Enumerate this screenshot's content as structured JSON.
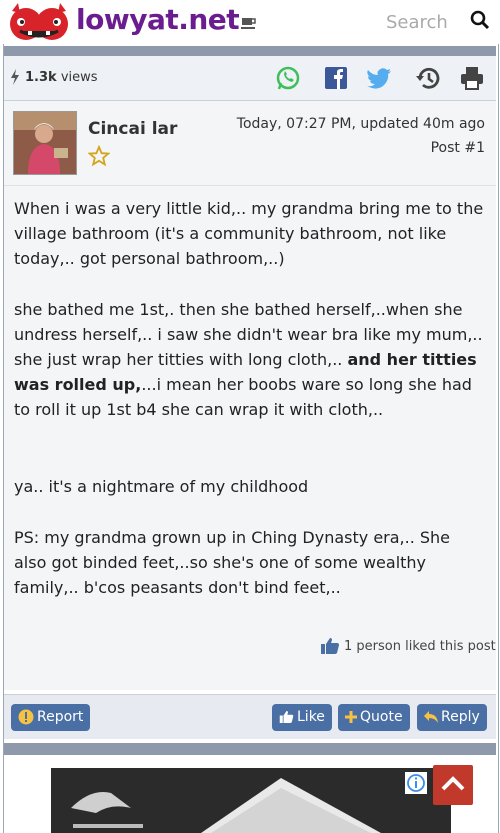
{
  "header": {
    "brand": "lowyat.net",
    "search_placeholder": "Search"
  },
  "stats": {
    "views_count": "1.3k",
    "views_label": "views"
  },
  "post": {
    "author": "Cincai lar",
    "time": "Today, 07:27 PM, updated 40m ago",
    "number": "Post #1",
    "para1": "When i was a very little kid,.. my grandma bring me to the village bathroom (it's a community bathroom, not like today,.. got personal bathroom,..)",
    "para2_a": "she bathed me 1st,. then she bathed herself,..when she undress herself,.. i saw she didn't wear bra like my mum,.. she just wrap her titties with long cloth,.. ",
    "para2_bold": "and her titties was rolled up,",
    "para2_b": "...i mean her boobs ware so long she had to roll it up 1st b4 she can wrap it with cloth,..",
    "para3": "ya.. it's a nightmare of my childhood",
    "para4": "PS: my grandma grown up in Ching Dynasty era,.. She also got binded feet,..so she's one of some wealthy family,.. b'cos peasants don't bind feet,..",
    "liked_text": "1 person liked this post"
  },
  "actions": {
    "report": "Report",
    "like": "Like",
    "quote": "Quote",
    "reply": "Reply"
  },
  "colors": {
    "brand": "#6b1d8f",
    "button": "#4a6fa5",
    "strip": "#8e9aab",
    "scroll_top": "#c0392b"
  }
}
